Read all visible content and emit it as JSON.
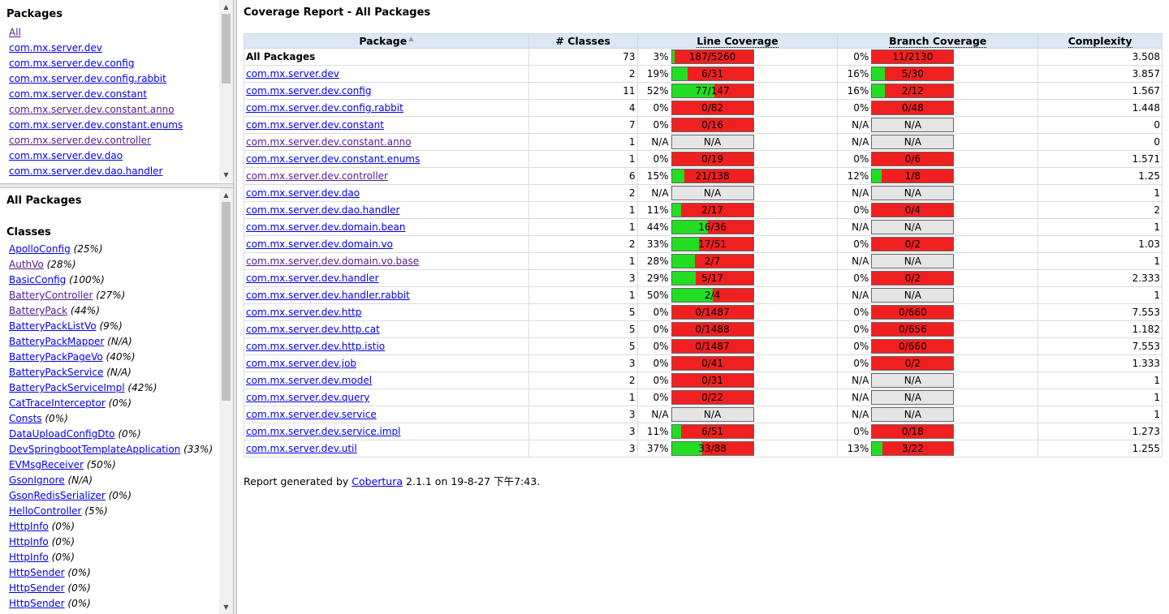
{
  "packages_frame": {
    "title": "Packages",
    "links": [
      {
        "label": "All",
        "visited": true
      },
      {
        "label": "com.mx.server.dev",
        "visited": false
      },
      {
        "label": "com.mx.server.dev.config",
        "visited": false
      },
      {
        "label": "com.mx.server.dev.config.rabbit",
        "visited": false
      },
      {
        "label": "com.mx.server.dev.constant",
        "visited": false
      },
      {
        "label": "com.mx.server.dev.constant.anno",
        "visited": true
      },
      {
        "label": "com.mx.server.dev.constant.enums",
        "visited": false
      },
      {
        "label": "com.mx.server.dev.controller",
        "visited": true
      },
      {
        "label": "com.mx.server.dev.dao",
        "visited": false
      },
      {
        "label": "com.mx.server.dev.dao.handler",
        "visited": false
      }
    ]
  },
  "classes_frame": {
    "title": "All Packages",
    "subtitle": "Classes",
    "classes": [
      {
        "name": "ApolloConfig",
        "pct": "(25%)",
        "visited": false
      },
      {
        "name": "AuthVo",
        "pct": "(28%)",
        "visited": true
      },
      {
        "name": "BasicConfig",
        "pct": "(100%)",
        "visited": false
      },
      {
        "name": "BatteryController",
        "pct": "(27%)",
        "visited": true
      },
      {
        "name": "BatteryPack",
        "pct": "(44%)",
        "visited": true
      },
      {
        "name": "BatteryPackListVo",
        "pct": "(9%)",
        "visited": false
      },
      {
        "name": "BatteryPackMapper",
        "pct": "(N/A)",
        "visited": false
      },
      {
        "name": "BatteryPackPageVo",
        "pct": "(40%)",
        "visited": false
      },
      {
        "name": "BatteryPackService",
        "pct": "(N/A)",
        "visited": false
      },
      {
        "name": "BatteryPackServiceImpl",
        "pct": "(42%)",
        "visited": false
      },
      {
        "name": "CatTraceInterceptor",
        "pct": "(0%)",
        "visited": false
      },
      {
        "name": "Consts",
        "pct": "(0%)",
        "visited": false
      },
      {
        "name": "DataUploadConfigDto",
        "pct": "(0%)",
        "visited": false
      },
      {
        "name": "DevSpringbootTemplateApplication",
        "pct": "(33%)",
        "visited": false
      },
      {
        "name": "EVMsgReceiver",
        "pct": "(50%)",
        "visited": false
      },
      {
        "name": "GsonIgnore",
        "pct": "(N/A)",
        "visited": false
      },
      {
        "name": "GsonRedisSerializer",
        "pct": "(0%)",
        "visited": false
      },
      {
        "name": "HelloController",
        "pct": "(5%)",
        "visited": false
      },
      {
        "name": "HttpInfo",
        "pct": "(0%)",
        "visited": false
      },
      {
        "name": "HttpInfo",
        "pct": "(0%)",
        "visited": false
      },
      {
        "name": "HttpInfo",
        "pct": "(0%)",
        "visited": false
      },
      {
        "name": "HttpSender",
        "pct": "(0%)",
        "visited": false
      },
      {
        "name": "HttpSender",
        "pct": "(0%)",
        "visited": false
      },
      {
        "name": "HttpSender",
        "pct": "(0%)",
        "visited": false
      }
    ]
  },
  "report": {
    "title": "Coverage Report - All Packages",
    "headers": {
      "package": "Package",
      "classes": "# Classes",
      "line": "Line Coverage",
      "branch": "Branch Coverage",
      "complexity": "Complexity"
    },
    "sort_icon": "▲",
    "rows": [
      {
        "name": "All Packages",
        "summary": true,
        "classes": "73",
        "line_pct": "3%",
        "line_frac": 0.03,
        "line_text": "187/5260",
        "branch_pct": "0%",
        "branch_frac": 0.0,
        "branch_text": "11/2130",
        "complexity": "3.508"
      },
      {
        "name": "com.mx.server.dev",
        "classes": "2",
        "line_pct": "19%",
        "line_frac": 0.19,
        "line_text": "6/31",
        "branch_pct": "16%",
        "branch_frac": 0.16,
        "branch_text": "5/30",
        "complexity": "3.857"
      },
      {
        "name": "com.mx.server.dev.config",
        "classes": "11",
        "line_pct": "52%",
        "line_frac": 0.52,
        "line_text": "77/147",
        "branch_pct": "16%",
        "branch_frac": 0.16,
        "branch_text": "2/12",
        "complexity": "1.567"
      },
      {
        "name": "com.mx.server.dev.config.rabbit",
        "classes": "4",
        "line_pct": "0%",
        "line_frac": 0.0,
        "line_text": "0/82",
        "branch_pct": "0%",
        "branch_frac": 0.0,
        "branch_text": "0/48",
        "complexity": "1.448"
      },
      {
        "name": "com.mx.server.dev.constant",
        "classes": "7",
        "line_pct": "0%",
        "line_frac": 0.0,
        "line_text": "0/16",
        "branch_pct": "N/A",
        "branch_na": true,
        "branch_text": "N/A",
        "complexity": "0"
      },
      {
        "name": "com.mx.server.dev.constant.anno",
        "visited": true,
        "classes": "1",
        "line_pct": "N/A",
        "line_na": true,
        "line_text": "N/A",
        "branch_pct": "N/A",
        "branch_na": true,
        "branch_text": "N/A",
        "complexity": "0"
      },
      {
        "name": "com.mx.server.dev.constant.enums",
        "classes": "1",
        "line_pct": "0%",
        "line_frac": 0.0,
        "line_text": "0/19",
        "branch_pct": "0%",
        "branch_frac": 0.0,
        "branch_text": "0/6",
        "complexity": "1.571"
      },
      {
        "name": "com.mx.server.dev.controller",
        "visited": true,
        "classes": "6",
        "line_pct": "15%",
        "line_frac": 0.15,
        "line_text": "21/138",
        "branch_pct": "12%",
        "branch_frac": 0.12,
        "branch_text": "1/8",
        "complexity": "1.25"
      },
      {
        "name": "com.mx.server.dev.dao",
        "classes": "2",
        "line_pct": "N/A",
        "line_na": true,
        "line_text": "N/A",
        "branch_pct": "N/A",
        "branch_na": true,
        "branch_text": "N/A",
        "complexity": "1"
      },
      {
        "name": "com.mx.server.dev.dao.handler",
        "classes": "1",
        "line_pct": "11%",
        "line_frac": 0.11,
        "line_text": "2/17",
        "branch_pct": "0%",
        "branch_frac": 0.0,
        "branch_text": "0/4",
        "complexity": "2"
      },
      {
        "name": "com.mx.server.dev.domain.bean",
        "classes": "1",
        "line_pct": "44%",
        "line_frac": 0.44,
        "line_text": "16/36",
        "branch_pct": "N/A",
        "branch_na": true,
        "branch_text": "N/A",
        "complexity": "1"
      },
      {
        "name": "com.mx.server.dev.domain.vo",
        "classes": "2",
        "line_pct": "33%",
        "line_frac": 0.33,
        "line_text": "17/51",
        "branch_pct": "0%",
        "branch_frac": 0.0,
        "branch_text": "0/2",
        "complexity": "1.03"
      },
      {
        "name": "com.mx.server.dev.domain.vo.base",
        "visited": true,
        "classes": "1",
        "line_pct": "28%",
        "line_frac": 0.28,
        "line_text": "2/7",
        "branch_pct": "N/A",
        "branch_na": true,
        "branch_text": "N/A",
        "complexity": "1"
      },
      {
        "name": "com.mx.server.dev.handler",
        "classes": "3",
        "line_pct": "29%",
        "line_frac": 0.29,
        "line_text": "5/17",
        "branch_pct": "0%",
        "branch_frac": 0.0,
        "branch_text": "0/2",
        "complexity": "2.333"
      },
      {
        "name": "com.mx.server.dev.handler.rabbit",
        "classes": "1",
        "line_pct": "50%",
        "line_frac": 0.5,
        "line_text": "2/4",
        "branch_pct": "N/A",
        "branch_na": true,
        "branch_text": "N/A",
        "complexity": "1"
      },
      {
        "name": "com.mx.server.dev.http",
        "classes": "5",
        "line_pct": "0%",
        "line_frac": 0.0,
        "line_text": "0/1487",
        "branch_pct": "0%",
        "branch_frac": 0.0,
        "branch_text": "0/660",
        "complexity": "7.553"
      },
      {
        "name": "com.mx.server.dev.http.cat",
        "classes": "5",
        "line_pct": "0%",
        "line_frac": 0.0,
        "line_text": "0/1488",
        "branch_pct": "0%",
        "branch_frac": 0.0,
        "branch_text": "0/656",
        "complexity": "1.182"
      },
      {
        "name": "com.mx.server.dev.http.istio",
        "classes": "5",
        "line_pct": "0%",
        "line_frac": 0.0,
        "line_text": "0/1487",
        "branch_pct": "0%",
        "branch_frac": 0.0,
        "branch_text": "0/660",
        "complexity": "7.553"
      },
      {
        "name": "com.mx.server.dev.job",
        "classes": "3",
        "line_pct": "0%",
        "line_frac": 0.0,
        "line_text": "0/41",
        "branch_pct": "0%",
        "branch_frac": 0.0,
        "branch_text": "0/2",
        "complexity": "1.333"
      },
      {
        "name": "com.mx.server.dev.model",
        "classes": "2",
        "line_pct": "0%",
        "line_frac": 0.0,
        "line_text": "0/31",
        "branch_pct": "N/A",
        "branch_na": true,
        "branch_text": "N/A",
        "complexity": "1"
      },
      {
        "name": "com.mx.server.dev.query",
        "classes": "1",
        "line_pct": "0%",
        "line_frac": 0.0,
        "line_text": "0/22",
        "branch_pct": "N/A",
        "branch_na": true,
        "branch_text": "N/A",
        "complexity": "1"
      },
      {
        "name": "com.mx.server.dev.service",
        "classes": "3",
        "line_pct": "N/A",
        "line_na": true,
        "line_text": "N/A",
        "branch_pct": "N/A",
        "branch_na": true,
        "branch_text": "N/A",
        "complexity": "1"
      },
      {
        "name": "com.mx.server.dev.service.impl",
        "classes": "3",
        "line_pct": "11%",
        "line_frac": 0.11,
        "line_text": "6/51",
        "branch_pct": "0%",
        "branch_frac": 0.0,
        "branch_text": "0/18",
        "complexity": "1.273"
      },
      {
        "name": "com.mx.server.dev.util",
        "classes": "3",
        "line_pct": "37%",
        "line_frac": 0.37,
        "line_text": "33/88",
        "branch_pct": "13%",
        "branch_frac": 0.13,
        "branch_text": "3/22",
        "complexity": "1.255"
      }
    ]
  },
  "footer": {
    "prefix": "Report generated by",
    "link": "Cobertura",
    "suffix": "2.1.1 on 19-8-27 下午7:43."
  },
  "colors": {
    "covered": "#22dd22",
    "uncovered": "#f02020",
    "na": "#e5e5e5",
    "header_bg": "#dbe7f5"
  }
}
